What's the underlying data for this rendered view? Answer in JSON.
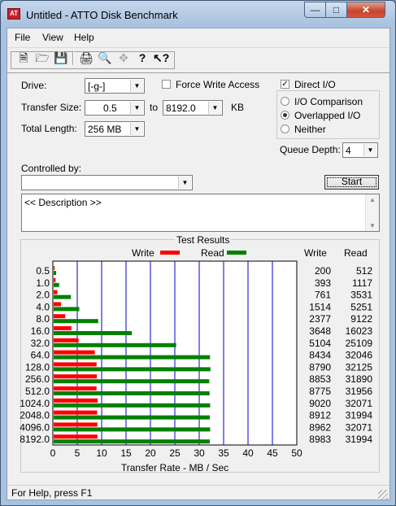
{
  "window": {
    "title": "Untitled - ATTO Disk Benchmark",
    "icon_name": "atto-app-icon"
  },
  "menu": [
    "File",
    "View",
    "Help"
  ],
  "toolbar_icons": [
    "new-icon",
    "open-icon",
    "save-icon",
    "print-icon",
    "print-preview-icon",
    "move-icon",
    "help-icon",
    "context-help-icon"
  ],
  "settings": {
    "drive_label": "Drive:",
    "drive_value": "[-g-]",
    "force_write_label": "Force Write Access",
    "force_write_checked": false,
    "direct_io_label": "Direct I/O",
    "direct_io_checked": true,
    "transfer_size_label": "Transfer Size:",
    "transfer_from": "0.5",
    "to_label": "to",
    "transfer_to": "8192.0",
    "unit_label": "KB",
    "total_length_label": "Total Length:",
    "total_length_value": "256 MB",
    "io_options": [
      {
        "label": "I/O Comparison",
        "selected": false
      },
      {
        "label": "Overlapped I/O",
        "selected": true
      },
      {
        "label": "Neither",
        "selected": false
      }
    ],
    "queue_depth_label": "Queue Depth:",
    "queue_depth_value": "4",
    "controlled_by_label": "Controlled by:",
    "controlled_by_value": "",
    "start_label": "Start",
    "description_text": "<< Description >>"
  },
  "results": {
    "title": "Test Results",
    "legend_write": "Write",
    "legend_read": "Read",
    "col_write": "Write",
    "col_read": "Read",
    "xlabel": "Transfer Rate - MB / Sec",
    "colors": {
      "write": "#ff0000",
      "read": "#008000",
      "grid": "#0000cc"
    }
  },
  "status": "For Help, press F1",
  "chart_data": {
    "type": "bar",
    "title": "Test Results",
    "xlabel": "Transfer Rate - MB / Sec",
    "xlim": [
      0,
      50
    ],
    "xticks": [
      0,
      5,
      10,
      15,
      20,
      25,
      30,
      35,
      40,
      45,
      50
    ],
    "categories": [
      "0.5",
      "1.0",
      "2.0",
      "4.0",
      "8.0",
      "16.0",
      "32.0",
      "64.0",
      "128.0",
      "256.0",
      "512.0",
      "1024.0",
      "2048.0",
      "4096.0",
      "8192.0"
    ],
    "series": [
      {
        "name": "Write",
        "values": [
          200,
          393,
          761,
          1514,
          2377,
          3648,
          5104,
          8434,
          8790,
          8853,
          8775,
          9020,
          8912,
          8962,
          8983
        ]
      },
      {
        "name": "Read",
        "values": [
          512,
          1117,
          3531,
          5251,
          9122,
          16023,
          25109,
          32046,
          32125,
          31890,
          31956,
          32071,
          31994,
          32071,
          31994
        ]
      }
    ],
    "units_note_scale": 1000
  }
}
